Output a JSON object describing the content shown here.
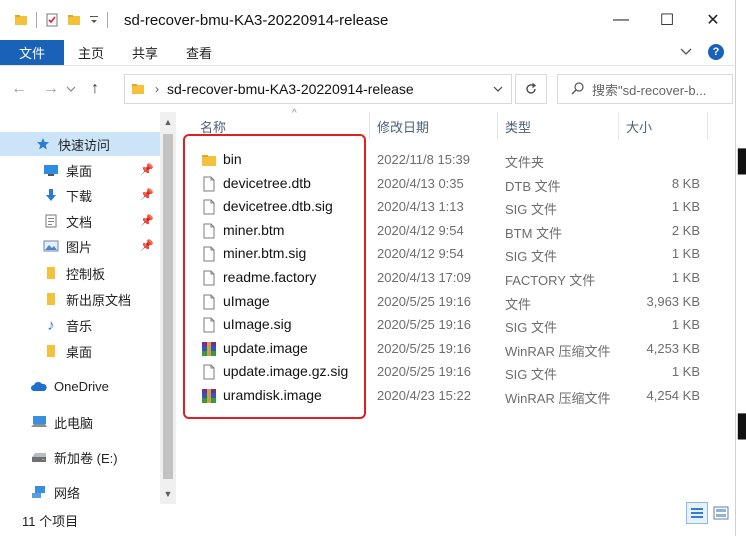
{
  "window": {
    "title": "sd-recover-bmu-KA3-20220914-release"
  },
  "window_controls": {
    "minimize": "—",
    "maximize": "☐",
    "close": "✕"
  },
  "ribbon": {
    "file": "文件",
    "tabs": [
      "主页",
      "共享",
      "查看"
    ]
  },
  "address": {
    "path": "sd-recover-bmu-KA3-20220914-release",
    "search_placeholder": "搜索\"sd-recover-b..."
  },
  "sidebar": {
    "items": [
      {
        "label": "快速访问",
        "icon": "star-icon"
      },
      {
        "label": "桌面",
        "icon": "desktop-icon"
      },
      {
        "label": "下载",
        "icon": "download-icon"
      },
      {
        "label": "文档",
        "icon": "document-icon"
      },
      {
        "label": "图片",
        "icon": "pictures-icon"
      },
      {
        "label": "控制板",
        "icon": "folder-icon"
      },
      {
        "label": "新出原文档",
        "icon": "folder-icon"
      },
      {
        "label": "音乐",
        "icon": "music-icon"
      },
      {
        "label": "桌面",
        "icon": "folder-icon"
      },
      {
        "label": "OneDrive",
        "icon": "cloud-icon"
      },
      {
        "label": "此电脑",
        "icon": "computer-icon"
      },
      {
        "label": "新加卷 (E:)",
        "icon": "drive-icon"
      },
      {
        "label": "网络",
        "icon": "network-icon"
      }
    ]
  },
  "columns": {
    "name": "名称",
    "date": "修改日期",
    "type": "类型",
    "size": "大小"
  },
  "files": [
    {
      "name": "bin",
      "date": "2022/11/8 15:39",
      "type": "文件夹",
      "size": "",
      "icon": "folder-icon"
    },
    {
      "name": "devicetree.dtb",
      "date": "2020/4/13 0:35",
      "type": "DTB 文件",
      "size": "8 KB",
      "icon": "file-icon"
    },
    {
      "name": "devicetree.dtb.sig",
      "date": "2020/4/13 1:13",
      "type": "SIG 文件",
      "size": "1 KB",
      "icon": "file-icon"
    },
    {
      "name": "miner.btm",
      "date": "2020/4/12 9:54",
      "type": "BTM 文件",
      "size": "2 KB",
      "icon": "file-icon"
    },
    {
      "name": "miner.btm.sig",
      "date": "2020/4/12 9:54",
      "type": "SIG 文件",
      "size": "1 KB",
      "icon": "file-icon"
    },
    {
      "name": "readme.factory",
      "date": "2020/4/13 17:09",
      "type": "FACTORY 文件",
      "size": "1 KB",
      "icon": "file-icon"
    },
    {
      "name": "uImage",
      "date": "2020/5/25 19:16",
      "type": "文件",
      "size": "3,963 KB",
      "icon": "file-icon"
    },
    {
      "name": "uImage.sig",
      "date": "2020/5/25 19:16",
      "type": "SIG 文件",
      "size": "1 KB",
      "icon": "file-icon"
    },
    {
      "name": "update.image",
      "date": "2020/5/25 19:16",
      "type": "WinRAR 压缩文件",
      "size": "4,253 KB",
      "icon": "winrar-icon"
    },
    {
      "name": "update.image.gz.sig",
      "date": "2020/5/25 19:16",
      "type": "SIG 文件",
      "size": "1 KB",
      "icon": "file-icon"
    },
    {
      "name": "uramdisk.image",
      "date": "2020/4/23 15:22",
      "type": "WinRAR 压缩文件",
      "size": "4,254 KB",
      "icon": "winrar-icon"
    }
  ],
  "status": {
    "item_count": "11 个项目"
  },
  "colors": {
    "accent": "#1a62b8",
    "selected": "#cce4f7",
    "highlight": "#e02020"
  }
}
